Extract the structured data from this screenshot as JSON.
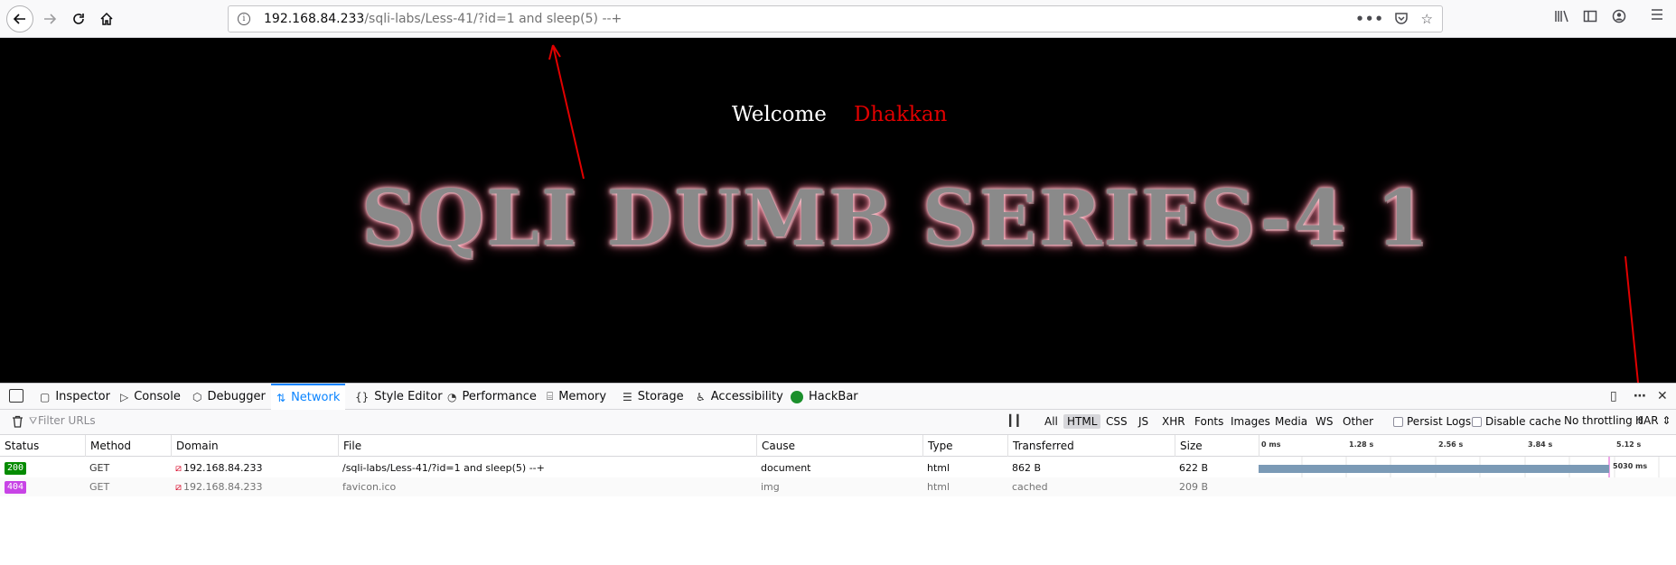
{
  "browser": {
    "url_host": "192.168.84.233",
    "url_path": "/sqli-labs/Less-41/?id=1 and sleep(5) --+",
    "page_actions": "•••"
  },
  "page": {
    "welcome": "Welcome",
    "welcome_name": "Dhakkan",
    "banner": "SQLI DUMB SERIES-4 1",
    "colors": {
      "background": "#000000",
      "name": "#e00000"
    }
  },
  "devtools": {
    "tabs": [
      {
        "label": "Inspector",
        "icon": "inspector-icon"
      },
      {
        "label": "Console",
        "icon": "console-icon"
      },
      {
        "label": "Debugger",
        "icon": "debugger-icon"
      },
      {
        "label": "Network",
        "icon": "network-icon",
        "selected": true
      },
      {
        "label": "Style Editor",
        "icon": "style-editor-icon"
      },
      {
        "label": "Performance",
        "icon": "performance-icon"
      },
      {
        "label": "Memory",
        "icon": "memory-icon"
      },
      {
        "label": "Storage",
        "icon": "storage-icon"
      },
      {
        "label": "Accessibility",
        "icon": "accessibility-icon"
      },
      {
        "label": "HackBar",
        "icon": "hackbar-icon"
      }
    ],
    "filter_placeholder": "Filter URLs",
    "type_filters": [
      "All",
      "HTML",
      "CSS",
      "JS",
      "XHR",
      "Fonts",
      "Images",
      "Media",
      "WS",
      "Other"
    ],
    "active_type_filter": "HTML",
    "persist_logs": "Persist Logs",
    "disable_cache": "Disable cache",
    "throttling": "No throttling",
    "har": "HAR",
    "columns": [
      "Status",
      "Method",
      "Domain",
      "File",
      "Cause",
      "Type",
      "Transferred",
      "Size"
    ],
    "timeline_ticks": [
      "0 ms",
      "1.28 s",
      "2.56 s",
      "3.84 s",
      "5.12 s"
    ],
    "requests": [
      {
        "status": "200",
        "status_color": "#058b00",
        "method": "GET",
        "domain": "192.168.84.233",
        "file": "/sqli-labs/Less-41/?id=1 and sleep(5) --+",
        "cause": "document",
        "type": "html",
        "transferred": "862 B",
        "size": "622 B",
        "duration_label": "5030 ms",
        "duration_ms": 5030
      },
      {
        "status": "404",
        "status_color": "#c844e6",
        "method": "GET",
        "domain": "192.168.84.233",
        "file": "favicon.ico",
        "cause": "img",
        "type": "html",
        "transferred": "cached",
        "size": "209 B"
      }
    ]
  }
}
